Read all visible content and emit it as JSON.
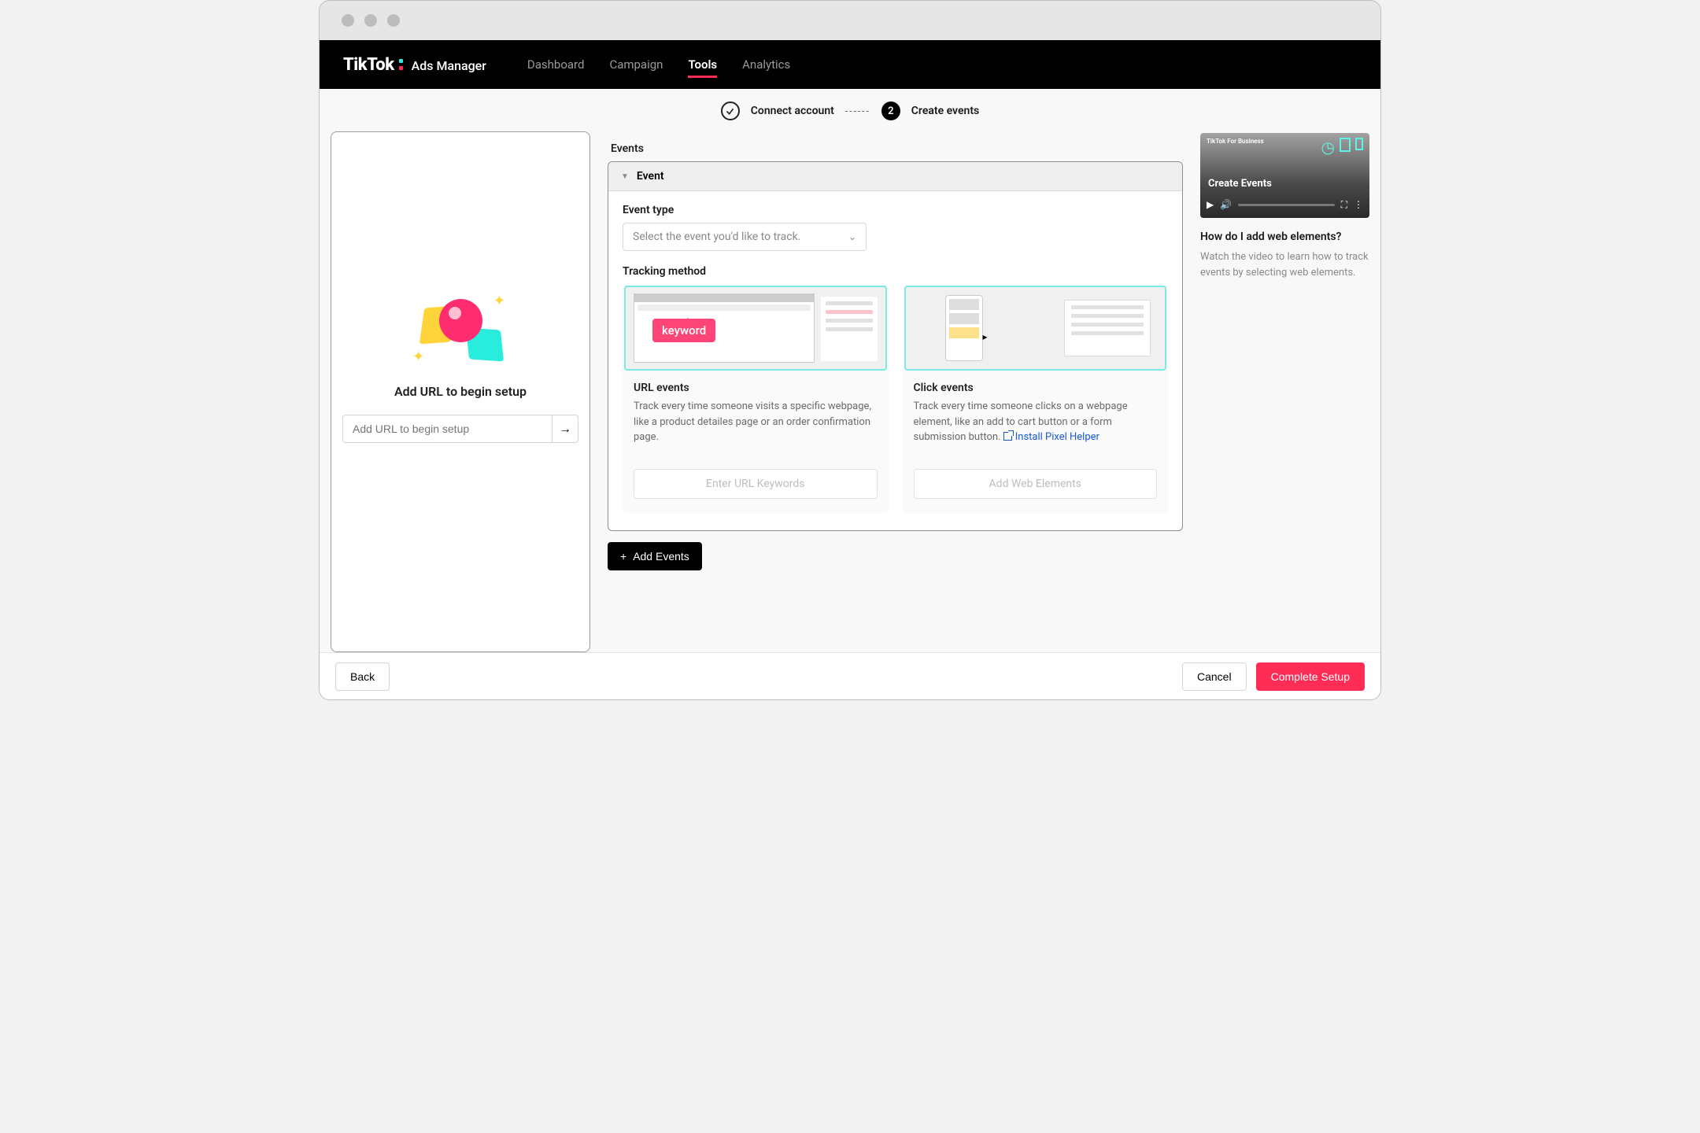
{
  "brand": {
    "name": "TikTok",
    "product": "Ads Manager"
  },
  "nav": {
    "items": [
      "Dashboard",
      "Campaign",
      "Tools",
      "Analytics"
    ],
    "activeIndex": 2
  },
  "stepper": {
    "step1": "Connect account",
    "step2_num": "2",
    "step2": "Create events",
    "separator": "------"
  },
  "leftPanel": {
    "title": "Add URL to begin setup",
    "placeholder": "Add URL to begin setup"
  },
  "events": {
    "sectionLabel": "Events",
    "cardTitle": "Event",
    "eventTypeLabel": "Event type",
    "eventTypePlaceholder": "Select the event you'd like to track.",
    "trackingLabel": "Tracking method",
    "urlOption": {
      "badge": "keyword",
      "title": "URL events",
      "desc": "Track every time someone visits a specific webpage, like a product detailes page or an order confirmation page.",
      "action": "Enter URL Keywords"
    },
    "clickOption": {
      "title": "Click events",
      "desc": "Track every time someone clicks on a webpage element, like an add to cart button or a form submission button.",
      "linkText": "Install Pixel Helper",
      "action": "Add Web Elements"
    },
    "addButton": "Add Events"
  },
  "rightPanel": {
    "videoTitle": "Create Events",
    "videoBrand": "TikTok For Business",
    "heading": "How do I add web elements?",
    "sub": "Watch the video to learn how to track events by selecting web elements."
  },
  "footer": {
    "back": "Back",
    "cancel": "Cancel",
    "complete": "Complete Setup"
  }
}
